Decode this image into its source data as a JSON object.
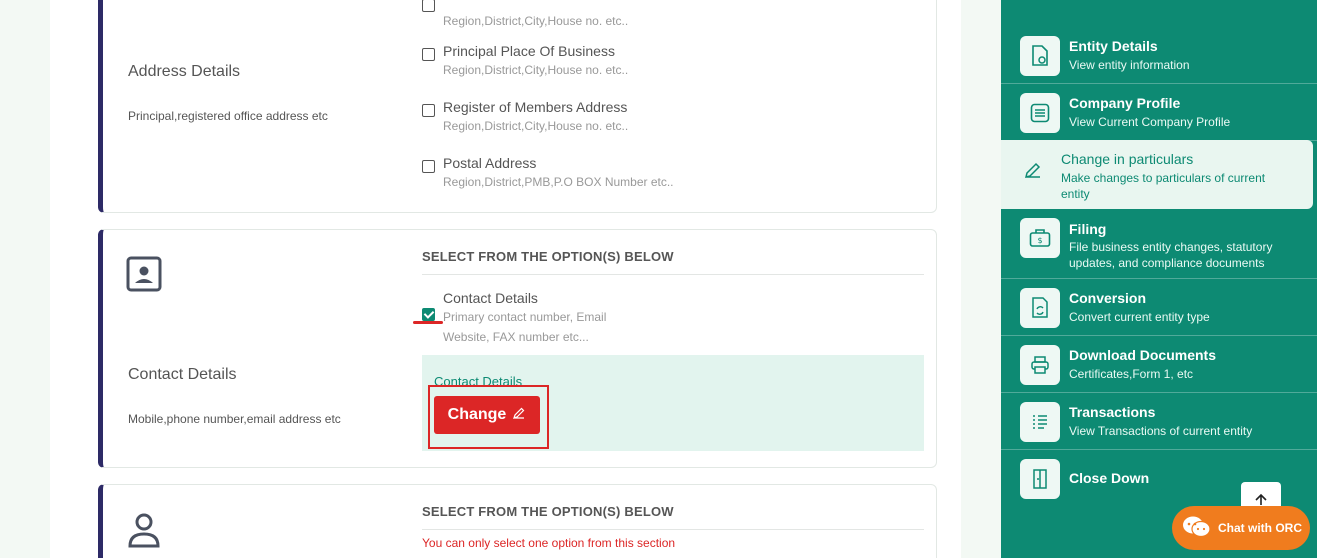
{
  "address_section": {
    "title": "Address Details",
    "subtitle": "Principal,registered office address etc",
    "options": [
      {
        "label": "",
        "desc": "Region,District,City,House no. etc..",
        "checked": false
      },
      {
        "label": "Principal Place Of Business",
        "desc": "Region,District,City,House no. etc..",
        "checked": false
      },
      {
        "label": "Register of Members Address",
        "desc": "Region,District,City,House no. etc..",
        "checked": false
      },
      {
        "label": "Postal Address",
        "desc": "Region,District,PMB,P.O BOX Number etc..",
        "checked": false
      }
    ]
  },
  "contact_section": {
    "title": "Contact Details",
    "subtitle": "Mobile,phone number,email address etc",
    "select_heading": "SELECT FROM THE OPTION(S) BELOW",
    "option": {
      "label": "Contact Details",
      "desc_line1": "Primary contact number, Email",
      "desc_line2": "Website, FAX number etc...",
      "checked": true
    },
    "panel_title": "Contact Details",
    "change_label": "Change"
  },
  "third_section": {
    "select_heading": "SELECT FROM THE OPTION(S) BELOW",
    "warning": "You can only select one option from this section"
  },
  "sidebar": {
    "items": [
      {
        "title": "Entity Details",
        "sub": "View entity information",
        "icon": "document-icon"
      },
      {
        "title": "Company Profile",
        "sub": "View Current Company Profile",
        "icon": "list-icon"
      },
      {
        "title": "Change in particulars",
        "sub": "Make changes to particulars of current entity",
        "icon": "edit-icon"
      },
      {
        "title": "Filing",
        "sub": "File business entity changes, statutory updates, and compliance documents",
        "icon": "briefcase-icon"
      },
      {
        "title": "Conversion",
        "sub": "Convert current entity type",
        "icon": "conversion-icon"
      },
      {
        "title": "Download Documents",
        "sub": "Certificates,Form 1, etc",
        "icon": "printer-icon"
      },
      {
        "title": "Transactions",
        "sub": "View Transactions of current entity",
        "icon": "transactions-icon"
      },
      {
        "title": "Close Down",
        "sub": "",
        "icon": "close-down-icon"
      }
    ]
  },
  "chat": {
    "label": "Chat with ORC"
  },
  "colors": {
    "accent": "#0d8a73",
    "danger": "#dc2626",
    "card_border": "#2d2a66",
    "chat": "#f07c1e"
  }
}
